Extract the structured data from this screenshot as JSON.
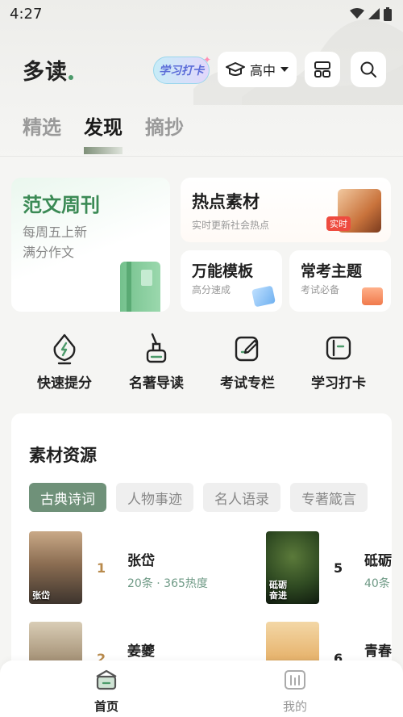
{
  "status": {
    "time": "4:27"
  },
  "header": {
    "logo": "多读",
    "checkin_badge": "学习打卡",
    "grade": "高中",
    "layout_icon": "layout-icon",
    "search_icon": "search-icon"
  },
  "tabs": [
    {
      "label": "精选",
      "active": false
    },
    {
      "label": "发现",
      "active": true
    },
    {
      "label": "摘抄",
      "active": false
    }
  ],
  "cards": {
    "weekly": {
      "title": "范文周刊",
      "line1": "每周五上新",
      "line2": "满分作文"
    },
    "hot": {
      "title": "热点素材",
      "sub": "实时更新社会热点",
      "tag": "实时"
    },
    "template": {
      "title": "万能模板",
      "sub": "高分速成"
    },
    "topic": {
      "title": "常考主题",
      "sub": "考试必备"
    }
  },
  "quick": [
    {
      "label": "快速提分",
      "icon": "bolt-pen-icon"
    },
    {
      "label": "名著导读",
      "icon": "ink-bottle-icon"
    },
    {
      "label": "考试专栏",
      "icon": "exam-pen-icon"
    },
    {
      "label": "学习打卡",
      "icon": "checkin-card-icon"
    }
  ],
  "materials": {
    "title": "素材资源",
    "chips": [
      "古典诗词",
      "人物事迹",
      "名人语录",
      "专著箴言"
    ],
    "active_chip": 0,
    "items": [
      {
        "rank": "1",
        "name": "张岱",
        "meta": "20条 · 365热度",
        "caption": "张岱",
        "rank_color": "#b88a4c"
      },
      {
        "rank": "5",
        "name": "砥砺",
        "meta": "40条",
        "caption": "砥砺\n奋进",
        "rank_color": "#222222"
      },
      {
        "rank": "2",
        "name": "姜夔",
        "meta": "",
        "caption": "",
        "rank_color": "#b88a4c"
      },
      {
        "rank": "6",
        "name": "青春",
        "meta": "",
        "caption": "",
        "rank_color": "#222222"
      }
    ]
  },
  "nav": [
    {
      "label": "首页",
      "icon": "home-icon",
      "active": true
    },
    {
      "label": "我的",
      "icon": "profile-icon",
      "active": false
    }
  ],
  "colors": {
    "accent": "#6f9179",
    "weekly_title": "#3b8a55",
    "hot_tag": "#ee4b3f"
  }
}
